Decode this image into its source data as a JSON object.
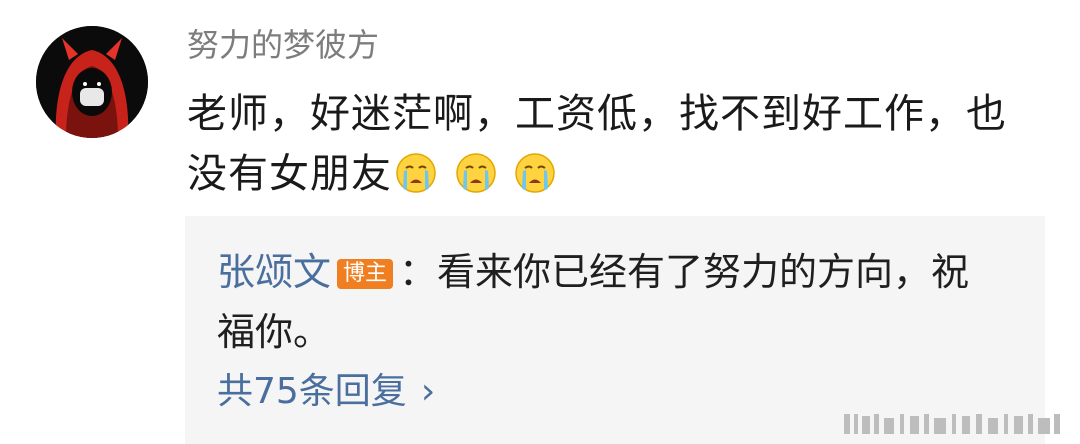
{
  "comment": {
    "username": "努力的梦彼方",
    "text": "老师，好迷茫啊，工资低，找不到好工作，也没有女朋友",
    "emojis": [
      "crying-face-icon",
      "crying-face-icon",
      "crying-face-icon"
    ]
  },
  "reply": {
    "author": "张颂文",
    "badge": "博主",
    "separator": "：",
    "text": "看来你已经有了努力的方向，祝福你。",
    "more_label": "共75条回复",
    "more_chevron": "›"
  },
  "colors": {
    "link": "#4a6f9e",
    "badge": "#f07f22",
    "reply_bg": "#f5f5f5"
  }
}
